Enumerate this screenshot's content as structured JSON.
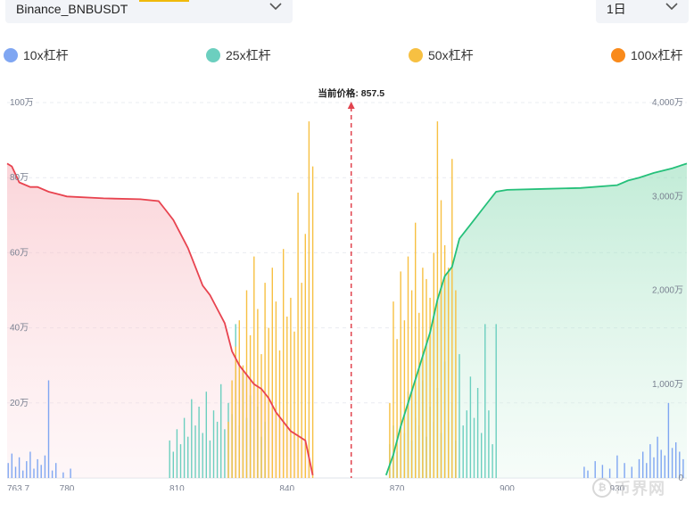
{
  "controls": {
    "symbol": "Binance_BNBUSDT",
    "period": "1日"
  },
  "legend": [
    {
      "label": "10x杠杆",
      "color": "#7fa6f2"
    },
    {
      "label": "25x杠杆",
      "color": "#6ccfbf"
    },
    {
      "label": "50x杠杆",
      "color": "#f7c042"
    },
    {
      "label": "100x杠杆",
      "color": "#f98a1b"
    }
  ],
  "watermark": "币界网",
  "chart_data": {
    "type": "bar",
    "current_price": {
      "label": "当前价格: 857.5",
      "value": 857.5
    },
    "x_ticks": [
      "763.7",
      "780",
      "810",
      "840",
      "870",
      "900",
      "930"
    ],
    "x_tick_values": [
      763.7,
      780,
      810,
      840,
      870,
      900,
      930
    ],
    "xlim": [
      763.7,
      949
    ],
    "left_axis": {
      "ticks": [
        "20万",
        "40万",
        "60万",
        "80万",
        "100万"
      ],
      "values": [
        200000,
        400000,
        600000,
        800000,
        1000000
      ],
      "ylim": [
        0,
        1000000
      ]
    },
    "right_axis": {
      "ticks": [
        "0",
        "1,000万",
        "2,000万",
        "3,000万",
        "4,000万"
      ],
      "values": [
        0,
        10000000,
        20000000,
        30000000,
        40000000
      ],
      "ylim": [
        0,
        40000000
      ]
    },
    "grid": true,
    "short_cumulative": {
      "color": "#e8434f",
      "x": [
        763.7,
        765,
        767,
        770,
        772,
        775,
        778,
        780,
        790,
        800,
        805,
        807,
        809,
        811,
        813,
        815,
        817,
        819,
        821,
        823,
        825,
        827,
        829,
        831,
        833,
        835,
        837,
        839,
        841,
        843,
        845,
        847
      ],
      "y": [
        33500000,
        33200000,
        31500000,
        31000000,
        31000000,
        30500000,
        30200000,
        30000000,
        29800000,
        29700000,
        29500000,
        28500000,
        27500000,
        26000000,
        24500000,
        22500000,
        20500000,
        19500000,
        18000000,
        16500000,
        13500000,
        12000000,
        11000000,
        10000000,
        9500000,
        8500000,
        7000000,
        6000000,
        5000000,
        4500000,
        4000000,
        300000
      ]
    },
    "long_cumulative": {
      "color": "#25c07a",
      "x": [
        867,
        869,
        871,
        873,
        875,
        877,
        879,
        881,
        883,
        885,
        887,
        889,
        891,
        893,
        895,
        897,
        900,
        910,
        920,
        930,
        933,
        936,
        940,
        945,
        949
      ],
      "y": [
        300000,
        2500000,
        5500000,
        8000000,
        10500000,
        13000000,
        15500000,
        19000000,
        21500000,
        22500000,
        25500000,
        26500000,
        27500000,
        28500000,
        29500000,
        30500000,
        30700000,
        30800000,
        30900000,
        31200000,
        31700000,
        32000000,
        32500000,
        33000000,
        33500000
      ]
    },
    "series": [
      {
        "name": "10x杠杆",
        "color": "#7fa6f2",
        "x": [
          764,
          765,
          766,
          767,
          768,
          769,
          770,
          771,
          772,
          773,
          774,
          775,
          776,
          777,
          779,
          781,
          921,
          922,
          924,
          926,
          928,
          930,
          932,
          934,
          936,
          937,
          938,
          939,
          940,
          941,
          942,
          943,
          944,
          945,
          946,
          947,
          948
        ],
        "y": [
          40000,
          65000,
          30000,
          55000,
          20000,
          45000,
          70000,
          25000,
          50000,
          35000,
          60000,
          260000,
          20000,
          40000,
          15000,
          25000,
          30000,
          20000,
          45000,
          35000,
          25000,
          60000,
          40000,
          30000,
          50000,
          70000,
          40000,
          90000,
          55000,
          110000,
          75000,
          60000,
          200000,
          80000,
          95000,
          70000,
          50000
        ]
      },
      {
        "name": "25x杠杆",
        "color": "#6ccfbf",
        "x": [
          808,
          809,
          810,
          811,
          812,
          813,
          814,
          815,
          816,
          817,
          818,
          819,
          820,
          821,
          822,
          823,
          824,
          825,
          826,
          827,
          828,
          829,
          830,
          831,
          832,
          833,
          834,
          868,
          869,
          870,
          871,
          872,
          873,
          874,
          875,
          876,
          877,
          878,
          879,
          880,
          881,
          882,
          883,
          884,
          885,
          886,
          887,
          888,
          889,
          890,
          891,
          892,
          893,
          894,
          895,
          896,
          897
        ],
        "y": [
          100000,
          70000,
          130000,
          90000,
          160000,
          110000,
          210000,
          140000,
          190000,
          120000,
          230000,
          100000,
          180000,
          150000,
          250000,
          130000,
          200000,
          170000,
          410000,
          140000,
          280000,
          160000,
          220000,
          130000,
          190000,
          110000,
          150000,
          90000,
          140000,
          70000,
          180000,
          120000,
          230000,
          100000,
          160000,
          140000,
          260000,
          110000,
          190000,
          150000,
          240000,
          120000,
          310000,
          150000,
          200000,
          100000,
          330000,
          140000,
          180000,
          270000,
          160000,
          240000,
          120000,
          410000,
          180000,
          90000,
          410000
        ]
      },
      {
        "name": "50x杠杆",
        "color": "#f7c042",
        "x": [
          824,
          825,
          826,
          827,
          828,
          829,
          830,
          831,
          832,
          833,
          834,
          835,
          836,
          837,
          838,
          839,
          840,
          841,
          842,
          843,
          844,
          845,
          846,
          847,
          868,
          869,
          870,
          871,
          872,
          873,
          874,
          875,
          876,
          877,
          878,
          879,
          880,
          881,
          882,
          883,
          884,
          885,
          886
        ],
        "y": [
          150000,
          260000,
          350000,
          420000,
          300000,
          500000,
          380000,
          590000,
          450000,
          330000,
          520000,
          400000,
          560000,
          470000,
          340000,
          610000,
          430000,
          480000,
          390000,
          760000,
          520000,
          650000,
          950000,
          830000,
          200000,
          470000,
          370000,
          550000,
          420000,
          590000,
          500000,
          680000,
          440000,
          560000,
          530000,
          480000,
          600000,
          950000,
          740000,
          620000,
          560000,
          850000,
          500000
        ]
      }
    ]
  }
}
